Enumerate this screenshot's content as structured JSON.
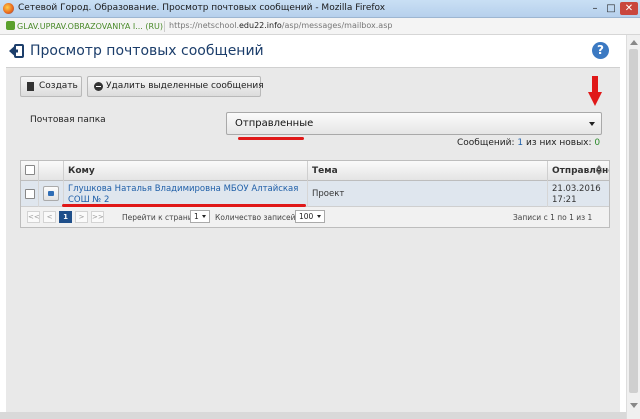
{
  "window": {
    "title": "Сетевой Город. Образование. Просмотр почтовых сообщений - Mozilla Firefox",
    "minimize": "–",
    "maximize": "□",
    "close": "✕"
  },
  "urlbar": {
    "site_identity": "GLAV.UPRAV.OBRAZOVANIYA I... (RU)",
    "url_prefix": "https://netschool.",
    "url_domain": "edu22.info",
    "url_path": "/asp/messages/mailbox.asp"
  },
  "header": {
    "title": "Просмотр почтовых сообщений",
    "help": "?"
  },
  "toolbar": {
    "create_label": "Создать",
    "delete_label": "Удалить выделенные сообщения"
  },
  "folder": {
    "label": "Почтовая папка",
    "selected": "Отправленные"
  },
  "counts": {
    "messages_label": "Сообщений:",
    "messages_count": "1",
    "new_label": "из них новых:",
    "new_count": "0"
  },
  "table": {
    "columns": [
      "Кому",
      "Тема",
      "Отправлено"
    ],
    "rows": [
      {
        "to": "Глушкова Наталья Владимировна МБОУ Алтайская СОШ № 2",
        "subject": "Проект",
        "sent_date": "21.03.2016",
        "sent_time": "17:21"
      }
    ]
  },
  "pager": {
    "first": "<<",
    "prev": "<",
    "current_page": "1",
    "next": ">",
    "last": ">>",
    "goto_label": "Перейти к странице:",
    "goto_value": "1",
    "records_label": "Количество записей:",
    "records_value": "100",
    "summary": "Записи с 1 по 1 из 1"
  },
  "colors": {
    "accent": "#1f5fa8",
    "annotation_red": "#e01818",
    "row_highlight": "#dfe6ee"
  }
}
